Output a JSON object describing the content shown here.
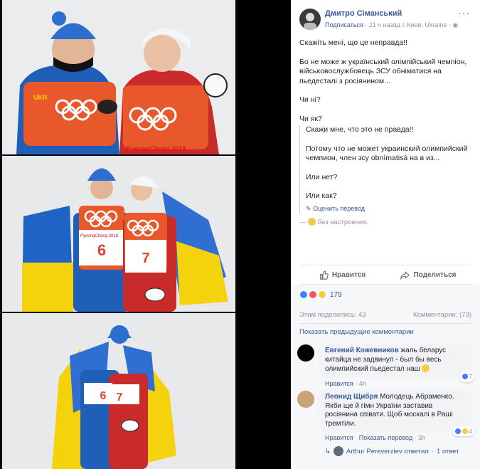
{
  "post": {
    "author": "Дмитро Сіманський",
    "subscribe": "Подписаться",
    "time_place": " · 21 ч назад с Киев, Ukraine · ",
    "text": [
      "Скажіть мені, що це неправда!!",
      "Бо не може ж український олімпійський чемпіон, військовослужбовець ЗСУ обніматися на пьедесталі з росіянином...",
      "Чи ні?",
      "Чи як?"
    ],
    "translation": [
      "Скажи мне, что это не правда!!",
      "Потому что не может украинский олимпийский чемпион, член зсу obnímatisá на в из...",
      "Или нет?",
      "Или как?"
    ],
    "rate_translation": "Оценить перевод",
    "feeling": "без настроения."
  },
  "actions": {
    "like": "Нравится",
    "share": "Поделиться"
  },
  "stats": {
    "reactions_count": "179",
    "shares": "Этим поделились: 43",
    "comments": "Комментарии: (73)",
    "show_previous": "Показать предыдущие комментарии"
  },
  "comments": [
    {
      "name": "Евгений Кожевников",
      "text": " жаль беларус китайца не задвинул - был бы весь олимпийский пьедестал наш ",
      "link_like": "Нравится",
      "dot": " · ",
      "time": "4h",
      "reactions": "7"
    },
    {
      "name": "Леонид Щибря",
      "text": " Молодець Абраменко. Якби ще й гімн України заставив росіянина співати. Щоб москалі в Раші тремтіли.",
      "link_like": "Нравится",
      "dot": " · ",
      "link_translate": "Показать перевод",
      "time": "3h",
      "reactions": "4"
    }
  ],
  "reply": {
    "author": "Arthur Pereverziev ответил",
    "count": "1 ответ"
  },
  "colors": {
    "link": "#365899",
    "like": "#4080ff",
    "love": "#f25268",
    "haha": "#f7c948"
  },
  "photos": {
    "olympic_banner": "PyeongChang 2018",
    "bibs": [
      "6",
      "7"
    ],
    "ukr_patch": "UKR"
  }
}
